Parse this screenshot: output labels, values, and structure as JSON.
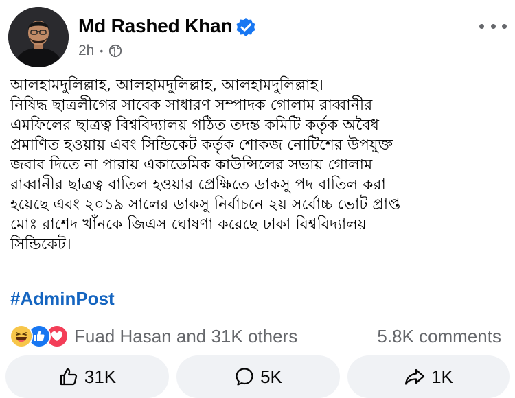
{
  "author": {
    "name": "Md Rashed Khan",
    "verified": true,
    "time": "2h",
    "separator": "•",
    "privacy_icon": "globe-icon"
  },
  "menu_icon": "more-horizontal-icon",
  "post": {
    "lines": [
      "আলহামদুলিল্লাহ, আলহামদুলিল্লাহ, আলহামদুলিল্লাহ।",
      "নিষিদ্ধ ছাত্রলীগের সাবেক সাধারণ সম্পাদক গোলাম রাব্বানীর",
      "এমফিলের ছাত্রত্ব বিশ্ববিদ্যালয় গঠিত তদন্ত কমিটি কর্তৃক অবৈধ",
      "প্রমাণিত হওয়ায় এবং সিন্ডিকেট কর্তৃক শোকজ নোটিশের উপযুক্ত",
      "জবাব দিতে না পারায় একাডেমিক কাউন্সিলের সভায় গোলাম",
      "রাব্বানীর ছাত্রত্ব বাতিল হওয়ার প্রেক্ষিতে ডাকসু পদ বাতিল করা",
      "হয়েছে এবং ২০১৯ সালের ডাকসু নির্বাচনে ২য় সর্বোচ্চ ভোট প্রাপ্ত",
      "মোঃ রাশেদ খাঁনকে জিএস ঘোষণা করেছে ঢাকা বিশ্ববিদ্যালয়",
      "সিন্ডিকেট।"
    ],
    "hashtag": "#AdminPost"
  },
  "reactions": {
    "icons": [
      "haha-icon",
      "like-icon",
      "love-icon"
    ],
    "summary": "Fuad Hasan and 31K others",
    "comments": "5.8K comments"
  },
  "actions": {
    "like": {
      "icon": "thumbs-up-icon",
      "count": "31K"
    },
    "comment": {
      "icon": "comment-icon",
      "count": "5K"
    },
    "share": {
      "icon": "share-icon",
      "count": "1K"
    }
  },
  "colors": {
    "hashtag": "#1565c0",
    "verified_badge": "#1877f2",
    "secondary_text": "#65676b",
    "button_bg": "#f0f2f5"
  }
}
